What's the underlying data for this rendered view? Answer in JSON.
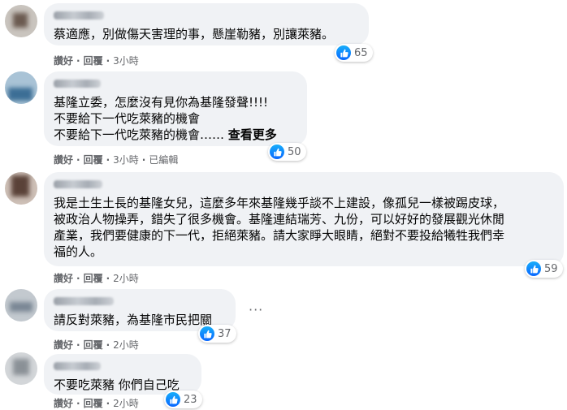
{
  "actions": {
    "like": "讚好",
    "reply": "回覆",
    "sep": "·"
  },
  "comments": [
    {
      "text": "蔡適應，別做傷天害理的事，懸崖勒豬，別讓萊豬。",
      "time": "3小時",
      "reactions": "65"
    },
    {
      "text": "基隆立委，怎麼沒有見你為基隆發聲!!!!\n不要給下一代吃萊豬的機會\n不要給下一代吃萊豬的機會…… ",
      "see_more": "查看更多",
      "time": "3小時",
      "edited": "已編輯",
      "reactions": "50"
    },
    {
      "text": "我是土生土長的基隆女兒，這麼多年來基隆幾乎談不上建設，像孤兒一樣被踢皮球，\n被政治人物操弄，錯失了很多機會。基隆連結瑞芳、九份，可以好好的發展觀光休閒\n產業，我們要健康的下一代，拒絕萊豬。請大家睜大眼睛，絕對不要投給犧牲我們幸\n福的人。",
      "time": "2小時",
      "reactions": "59"
    },
    {
      "text": "請反對萊豬，為基隆市民把關",
      "time": "2小時",
      "reactions": "37",
      "more_menu": "···"
    },
    {
      "text": "不要吃萊豬 你們自己吃",
      "time": "2小時",
      "reactions": "23"
    }
  ],
  "colors": {
    "bubble": "#f0f2f5",
    "meta": "#65676b",
    "like_blue": "#0866ff"
  },
  "icons": {
    "reaction": "like-thumb-icon",
    "more": "more-dots-icon"
  }
}
